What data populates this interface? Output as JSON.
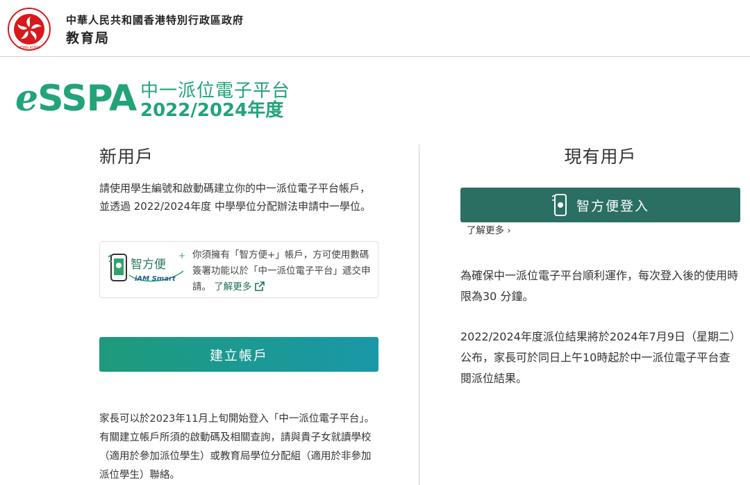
{
  "header": {
    "gov_name": "中華人民共和國香港特別行政區政府",
    "dept_name": "教育局",
    "emblem_text": "HONG KONG"
  },
  "logo": {
    "e": "e",
    "sspa": "SSPA",
    "subtitle1": "中一派位電子平台",
    "subtitle2": "2022/2024年度"
  },
  "new_user": {
    "title": "新用戶",
    "description": "請使用學生編號和啟動碼建立你的中一派位電子平台帳戶，並透過 2022/2024年度 中學學位分配辦法申請中一學位。",
    "iam_logo_text": "智方便",
    "iam_logo_sub": "iAM Smart",
    "iam_text": "你須擁有「智方便+」帳戶，方可使用數碼簽署功能以於「中一派位電子平台」遞交申請。",
    "iam_link": "了解更多",
    "create_button": "建立帳戶",
    "note": "家長可以於2023年11月上旬開始登入「中一派位電子平台」。有關建立帳戶所須的啟動碼及相關查詢，請與貴子女就讀學校（適用於參加派位學生）或教育局學位分配組（適用於非參加派位學生）聯絡。"
  },
  "existing_user": {
    "title": "現有用戶",
    "login_button": "智方便登入",
    "learn_more": "了解更多 ›",
    "para1": "為確保中一派位電子平台順利運作，每次登入後的使用時限為30 分鐘。",
    "para2": "2022/2024年度派位結果將於2024年7月9日（星期二）公布，家長可於同日上午10時起於中一派位電子平台查閱派位結果。"
  },
  "colors": {
    "brand_green": "#22a37a",
    "login_button": "#2a6f62",
    "emblem_red": "#d7191c"
  }
}
